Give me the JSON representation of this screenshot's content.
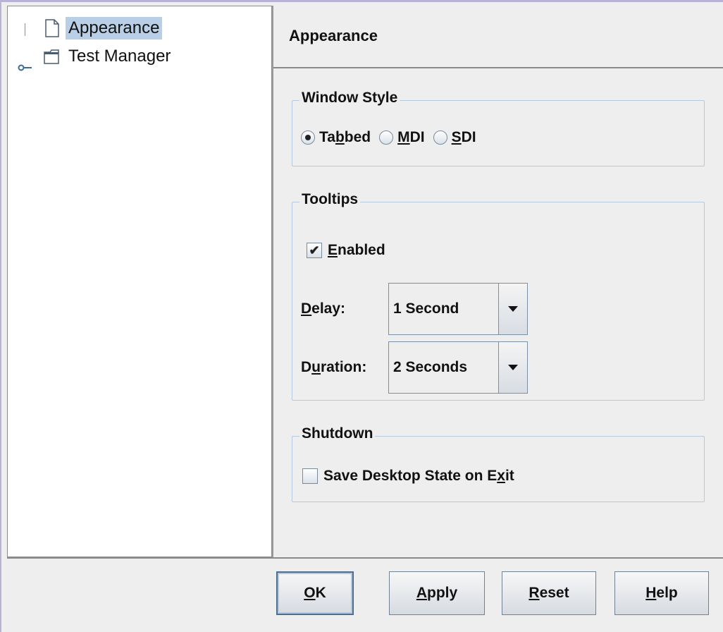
{
  "tree": {
    "items": [
      {
        "label": "Appearance",
        "icon": "document-icon",
        "selected": true
      },
      {
        "label": "Test Manager",
        "icon": "folder-icon",
        "selected": false
      }
    ]
  },
  "header": {
    "title": "Appearance"
  },
  "window_style": {
    "legend": "Window Style",
    "options": [
      {
        "pre": "Ta",
        "mn": "b",
        "post": "bed",
        "checked": true
      },
      {
        "pre": "",
        "mn": "M",
        "post": "DI",
        "checked": false
      },
      {
        "pre": "",
        "mn": "S",
        "post": "DI",
        "checked": false
      }
    ]
  },
  "tooltips": {
    "legend": "Tooltips",
    "enabled": {
      "pre": "",
      "mn": "E",
      "post": "nabled",
      "checked": true
    },
    "delay": {
      "label_pre": "",
      "label_mn": "D",
      "label_post": "elay:",
      "value": "1 Second"
    },
    "duration": {
      "label_pre": "D",
      "label_mn": "u",
      "label_post": "ration:",
      "value": "2 Seconds"
    }
  },
  "shutdown": {
    "legend": "Shutdown",
    "save_state": {
      "pre": "Save Desktop State on E",
      "mn": "x",
      "post": "it",
      "checked": false
    }
  },
  "buttons": [
    {
      "pre": "",
      "mn": "O",
      "post": "K"
    },
    {
      "pre": "",
      "mn": "A",
      "post": "pply"
    },
    {
      "pre": "",
      "mn": "R",
      "post": "eset"
    },
    {
      "pre": "",
      "mn": "H",
      "post": "elp"
    }
  ],
  "colors": {
    "selection": "#b8cfe5",
    "group_border": "#b7c9dd",
    "background": "#eeeeee"
  }
}
